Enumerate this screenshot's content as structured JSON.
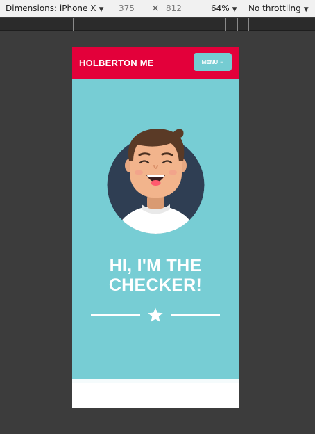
{
  "devtools": {
    "device_label": "Dimensions: iPhone X",
    "width": "375",
    "times": "×",
    "height": "812",
    "zoom": "64%",
    "throttling": "No throttling"
  },
  "site": {
    "brand": "HOLBERTON ME",
    "menu_label": "MENU",
    "hero_title_line1": "HI, I'M THE",
    "hero_title_line2": "CHECKER!"
  },
  "icons": {
    "menu": "hamburger-icon",
    "divider": "star-icon",
    "caret": "caret-down-icon"
  },
  "colors": {
    "header": "#e3003a",
    "hero": "#77cdd4",
    "menu_button": "#75ccd2",
    "avatar_bg": "#2f3e53"
  }
}
